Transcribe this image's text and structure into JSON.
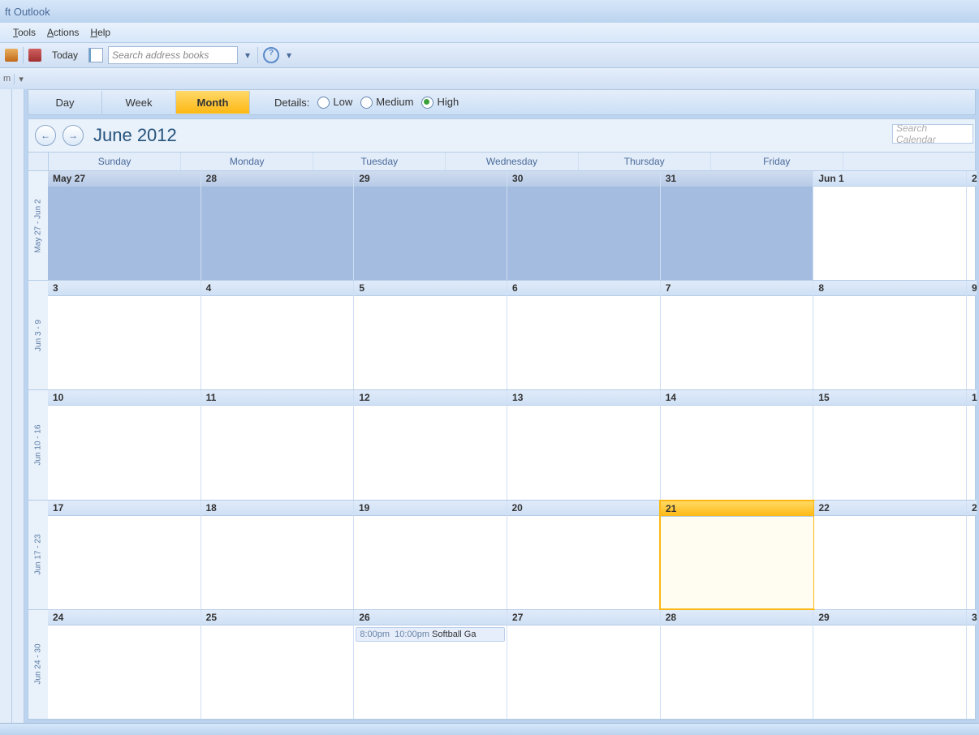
{
  "title_suffix": "ft Outlook",
  "menu": {
    "tools": "Tools",
    "actions": "Actions",
    "help": "Help"
  },
  "toolbar": {
    "today": "Today",
    "search_placeholder": "Search address books"
  },
  "toolbar2_text": "m",
  "view": {
    "day": "Day",
    "week": "Week",
    "month": "Month",
    "active": "month"
  },
  "details": {
    "label": "Details:",
    "low": "Low",
    "medium": "Medium",
    "high": "High",
    "selected": "high"
  },
  "month_title": "June 2012",
  "search_calendar_placeholder": "Search Calendar",
  "weekdays": [
    "Sunday",
    "Monday",
    "Tuesday",
    "Wednesday",
    "Thursday",
    "Friday"
  ],
  "week_labels": [
    "May 27 - Jun 2",
    "Jun 3 - 9",
    "Jun 10 - 16",
    "Jun 17 - 23",
    "Jun 24 - 30"
  ],
  "weeks": [
    {
      "cells": [
        {
          "label": "May 27",
          "prev": true
        },
        {
          "label": "28",
          "prev": true
        },
        {
          "label": "29",
          "prev": true
        },
        {
          "label": "30",
          "prev": true
        },
        {
          "label": "31",
          "prev": true
        },
        {
          "label": "Jun 1"
        }
      ],
      "tail": "2"
    },
    {
      "cells": [
        {
          "label": "3"
        },
        {
          "label": "4"
        },
        {
          "label": "5"
        },
        {
          "label": "6"
        },
        {
          "label": "7"
        },
        {
          "label": "8"
        }
      ],
      "tail": "9"
    },
    {
      "cells": [
        {
          "label": "10"
        },
        {
          "label": "11"
        },
        {
          "label": "12"
        },
        {
          "label": "13"
        },
        {
          "label": "14"
        },
        {
          "label": "15"
        }
      ],
      "tail": "1"
    },
    {
      "cells": [
        {
          "label": "17"
        },
        {
          "label": "18"
        },
        {
          "label": "19"
        },
        {
          "label": "20"
        },
        {
          "label": "21",
          "today": true
        },
        {
          "label": "22"
        }
      ],
      "tail": "2"
    },
    {
      "cells": [
        {
          "label": "24"
        },
        {
          "label": "25"
        },
        {
          "label": "26",
          "events": [
            {
              "start": "8:00pm",
              "end": "10:00pm",
              "title": "Softball Ga"
            }
          ]
        },
        {
          "label": "27"
        },
        {
          "label": "28"
        },
        {
          "label": "29"
        }
      ],
      "tail": "3"
    }
  ]
}
